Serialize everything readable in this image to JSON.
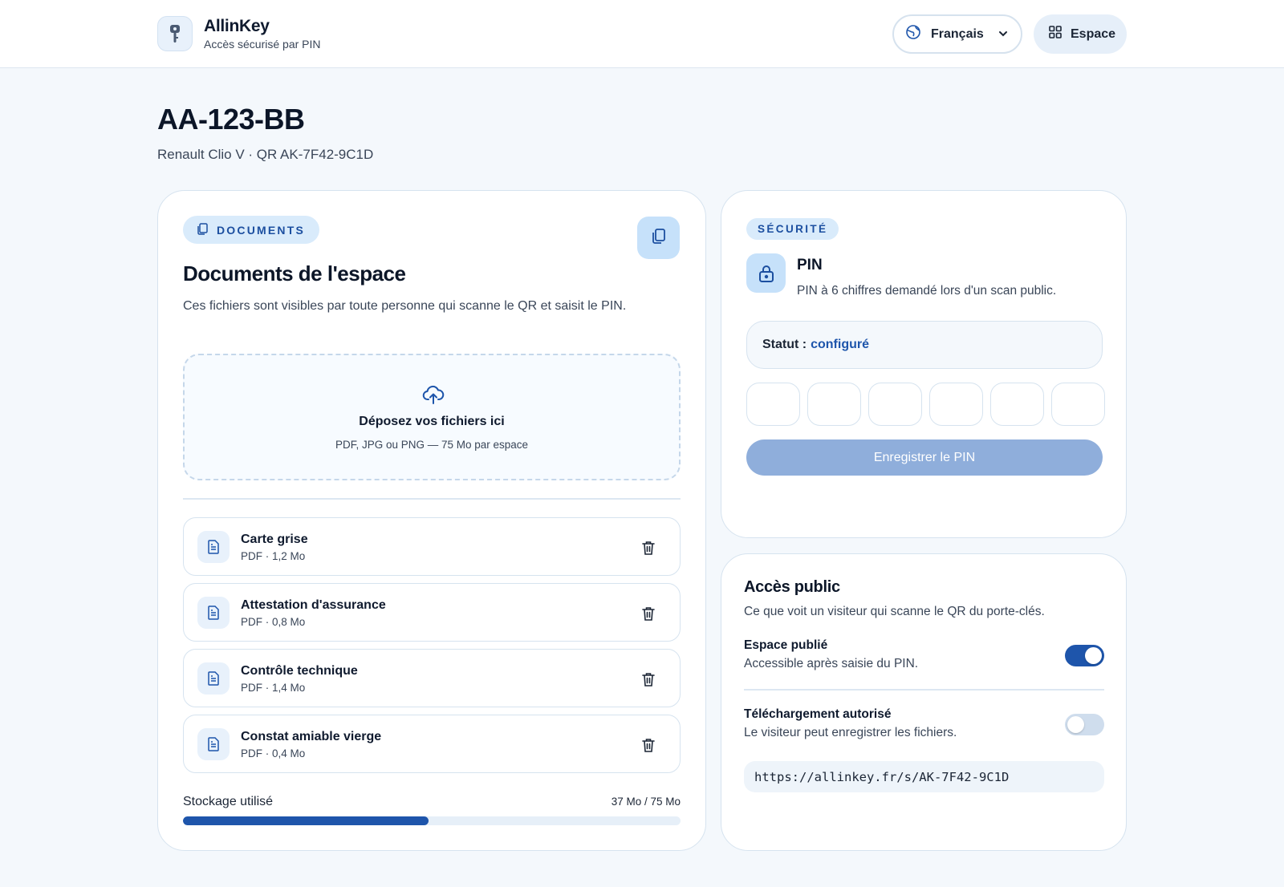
{
  "header": {
    "brand_name": "AllinKey",
    "brand_subtitle": "Accès sécurisé par PIN",
    "language": "Français",
    "space_button": "Espace"
  },
  "page": {
    "title": "AA-123-BB",
    "subtitle": "Renault Clio V · QR AK-7F42-9C1D"
  },
  "documents": {
    "pill": "DOCUMENTS",
    "title": "Documents de l'espace",
    "description": "Ces fichiers sont visibles par toute personne qui scanne le QR et saisit le PIN.",
    "dropzone_title": "Déposez vos fichiers ici",
    "dropzone_sub": "PDF, JPG ou PNG — 75 Mo par espace",
    "files": [
      {
        "name": "Carte grise",
        "meta": "PDF · 1,2 Mo"
      },
      {
        "name": "Attestation d'assurance",
        "meta": "PDF · 0,8 Mo"
      },
      {
        "name": "Contrôle technique",
        "meta": "PDF · 1,4 Mo"
      },
      {
        "name": "Constat amiable vierge",
        "meta": "PDF · 0,4 Mo"
      }
    ],
    "storage_label": "Stockage utilisé",
    "storage_value": "37 Mo / 75 Mo",
    "storage_used_fraction": 0.493
  },
  "security": {
    "pill": "SÉCURITÉ",
    "title": "PIN",
    "description": "PIN à 6 chiffres demandé lors d'un scan public.",
    "status_label": "Statut :",
    "status_value": "configuré",
    "pin_digits": [
      "",
      "",
      "",
      "",
      "",
      ""
    ],
    "save_button": "Enregistrer le PIN"
  },
  "public_access": {
    "title": "Accès public",
    "description": "Ce que voit un visiteur qui scanne le QR du porte-clés.",
    "options": [
      {
        "title": "Espace publié",
        "description": "Accessible après saisie du PIN.",
        "enabled": true
      },
      {
        "title": "Téléchargement autorisé",
        "description": "Le visiteur peut enregistrer les fichiers.",
        "enabled": false
      }
    ],
    "url": "https://allinkey.fr/s/AK-7F42-9C1D"
  },
  "colors": {
    "accent": "#1e55ab",
    "accent_light": "#c6e1fa",
    "background": "#f4f8fc"
  },
  "icons": {
    "brand": "key-icon",
    "language": "globe-icon",
    "space": "grid-icon",
    "documents": "copy-icon",
    "upload": "cloud-upload-icon",
    "file": "file-text-icon",
    "delete": "trash-icon",
    "lock": "lock-icon"
  }
}
